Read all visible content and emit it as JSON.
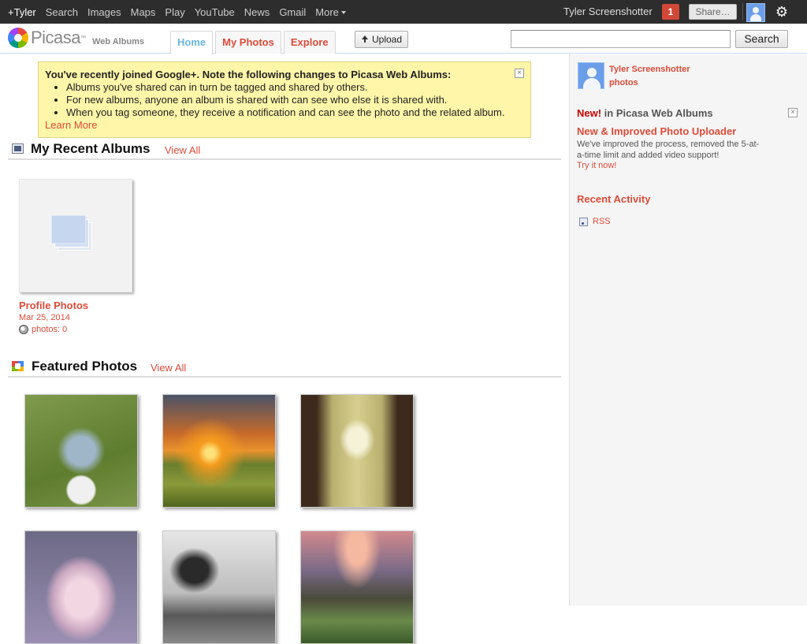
{
  "gbar": {
    "items": [
      "+Tyler",
      "Search",
      "Images",
      "Maps",
      "Play",
      "YouTube",
      "News",
      "Gmail"
    ],
    "more_label": "More",
    "user_name": "Tyler Screenshotter",
    "notification_count": "1",
    "share_placeholder": "Share…"
  },
  "header": {
    "logo_text": "Picasa",
    "logo_tm": "™",
    "logo_sub": "Web Albums",
    "tabs": [
      {
        "label": "Home"
      },
      {
        "label": "My Photos"
      },
      {
        "label": "Explore"
      }
    ],
    "upload_label": "Upload",
    "search_value": "",
    "search_label": "Search"
  },
  "notice": {
    "title": "You've recently joined Google+. Note the following changes to Picasa Web Albums:",
    "bullets": [
      "Albums you've shared can in turn be tagged and shared by others.",
      "For new albums, anyone an album is shared with can see who else it is shared with.",
      "When you tag someone, they receive a notification and can see the photo and the related album."
    ],
    "link": "Learn More",
    "close": "×"
  },
  "recent_albums": {
    "title": "My Recent Albums",
    "view_all": "View All",
    "album": {
      "name": "Profile Photos",
      "date": "Mar 25, 2014",
      "count": "photos: 0"
    }
  },
  "featured": {
    "title": "Featured Photos",
    "view_all": "View All"
  },
  "sidebar": {
    "name": "Tyler Screenshotter",
    "photos": "photos",
    "new_label": "New!",
    "new_suffix": " in Picasa Web Albums",
    "close": "×",
    "feature_title": "New & Improved Photo Uploader",
    "feature_desc": "We've improved the process, removed the 5-at-a-time limit and added video support!",
    "try_link": "Try it now!",
    "recent_title": "Recent Activity",
    "rss": "RSS"
  },
  "icons": {
    "gear": "gear-icon",
    "globe": "globe-icon",
    "rss": "rss-icon",
    "upload": "upload-icon"
  },
  "colors": {
    "accent": "#dd4b39",
    "active_tab": "#69b6e0",
    "notice_bg": "#fff6a9",
    "gbar_bg": "#2d2d2d"
  }
}
